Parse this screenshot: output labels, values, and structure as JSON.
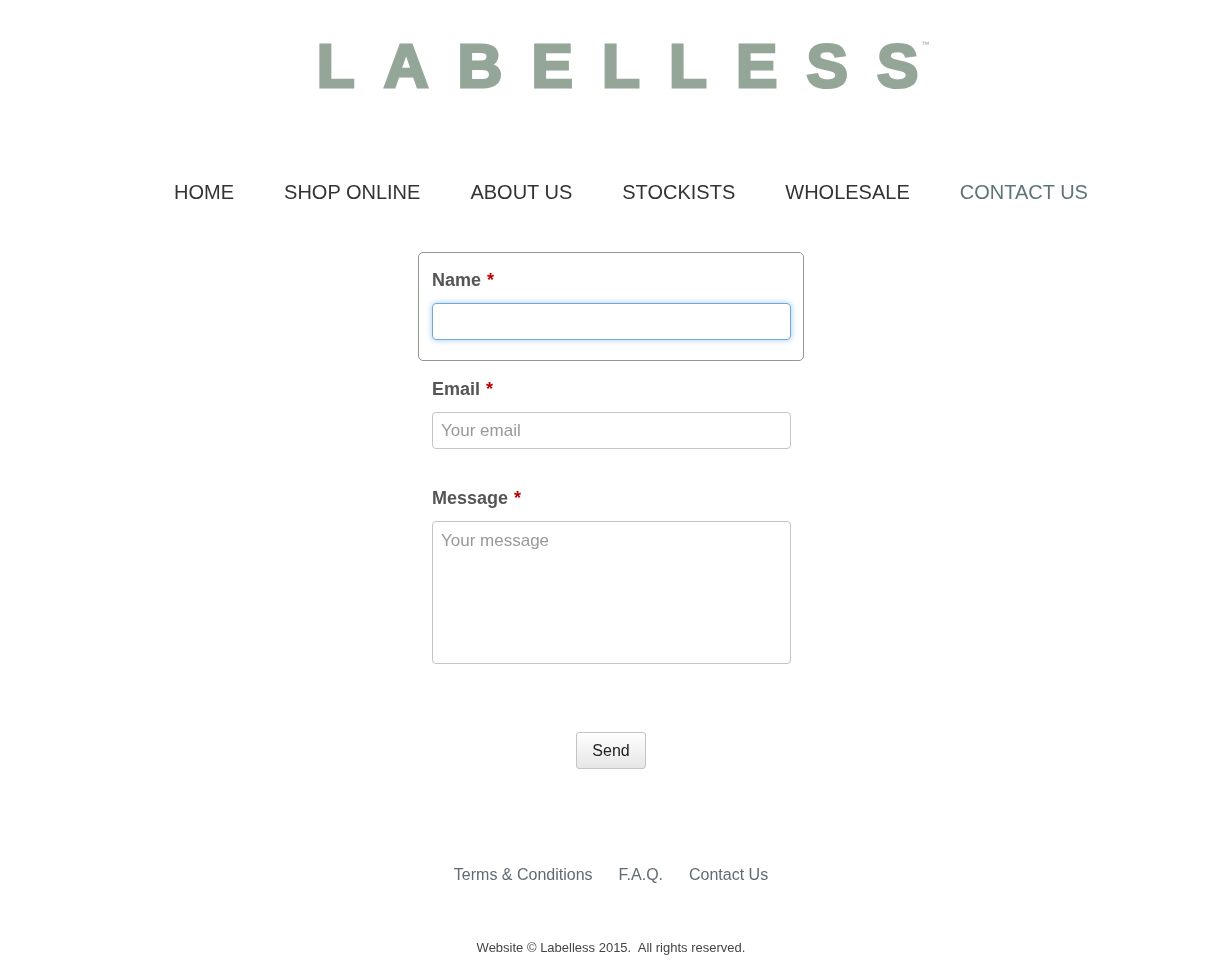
{
  "logo": {
    "text": "LABELLESS",
    "mark": "™"
  },
  "nav": [
    {
      "label": "HOME",
      "selected": false
    },
    {
      "label": "SHOP ONLINE",
      "selected": false
    },
    {
      "label": "ABOUT US",
      "selected": false
    },
    {
      "label": "STOCKISTS",
      "selected": false
    },
    {
      "label": "WHOLESALE",
      "selected": false
    },
    {
      "label": "CONTACT US",
      "selected": true
    }
  ],
  "form": {
    "fields": [
      {
        "kind": "input",
        "label": "Name",
        "required_mark": "*",
        "focused": true
      },
      {
        "kind": "input",
        "label": "Email",
        "required_mark": "*",
        "placeholder": "Your email",
        "focused": false
      },
      {
        "kind": "textarea",
        "label": "Message",
        "required_mark": "*",
        "placeholder": "Your message",
        "focused": false
      }
    ],
    "submit": "Send"
  },
  "footer": {
    "links": [
      "Terms & Conditions",
      "F.A.Q.",
      "Contact Us"
    ],
    "copyright": "Website © Labelless 2015.  All rights reserved."
  }
}
